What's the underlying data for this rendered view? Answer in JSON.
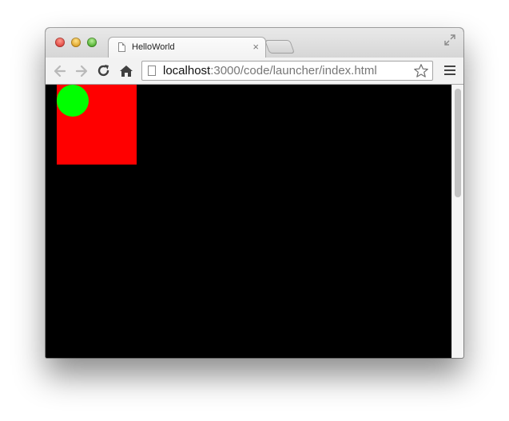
{
  "browser": {
    "tab": {
      "title": "HelloWorld",
      "close_glyph": "×"
    },
    "address_bar": {
      "url_host": "localhost",
      "url_rest": ":3000/code/launcher/index.html"
    },
    "icons": {
      "back": "back-arrow-icon",
      "forward": "forward-arrow-icon",
      "reload": "reload-icon",
      "home": "home-icon",
      "bookmark": "star-icon",
      "menu": "hamburger-menu-icon",
      "fullscreen": "fullscreen-icon",
      "page": "document-icon"
    }
  },
  "page": {
    "background_color": "#000000",
    "shapes": {
      "square_color": "#ff0000",
      "circle_color": "#00ff00"
    }
  },
  "colors": {
    "traffic_close": "#e0443e",
    "traffic_minimize": "#dea123",
    "traffic_maximize": "#4dae2c"
  }
}
